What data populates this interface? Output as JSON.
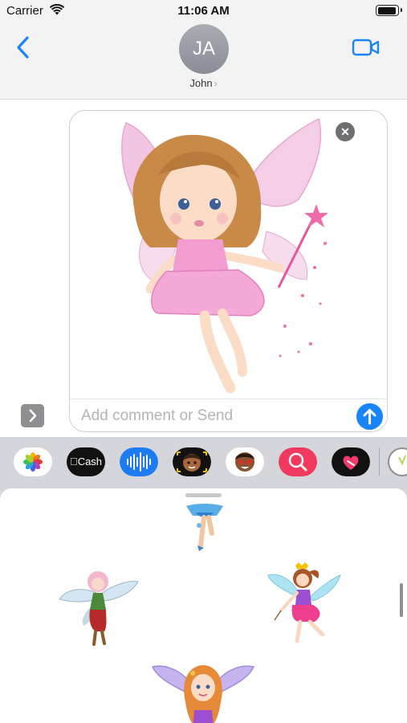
{
  "status_bar": {
    "carrier": "Carrier",
    "time": "11:06 AM"
  },
  "header": {
    "avatar_initials": "JA",
    "contact_name": "John",
    "contact_chevron": "›"
  },
  "compose": {
    "placeholder": "Add comment or Send",
    "value": "",
    "remove_symbol": "✕"
  },
  "app_drawer": {
    "apps": [
      {
        "name": "Photos",
        "icon": "photos-icon"
      },
      {
        "name": "Apple Cash",
        "label": "Cash",
        "icon": "apple-cash-icon"
      },
      {
        "name": "Audio",
        "icon": "audio-waveform-icon"
      },
      {
        "name": "Memoji",
        "icon": "memoji-icon"
      },
      {
        "name": "Memoji Stickers",
        "icon": "memoji-stickers-icon"
      },
      {
        "name": "Images Search",
        "icon": "image-search-icon"
      },
      {
        "name": "Digital Touch",
        "icon": "digital-touch-icon"
      },
      {
        "name": "Sticker App",
        "icon": "fairy-app-icon"
      }
    ]
  },
  "sticker_browser": {
    "stickers": [
      {
        "name": "blue-fairy-sticker"
      },
      {
        "name": "pink-hair-fairy-sticker"
      },
      {
        "name": "purple-dress-fairy-sticker"
      },
      {
        "name": "orange-hair-fairy-sticker"
      }
    ]
  },
  "colors": {
    "accent": "#1a84fb",
    "header_bg": "#f3f3f4",
    "drawer_bg": "#d4d6db"
  }
}
